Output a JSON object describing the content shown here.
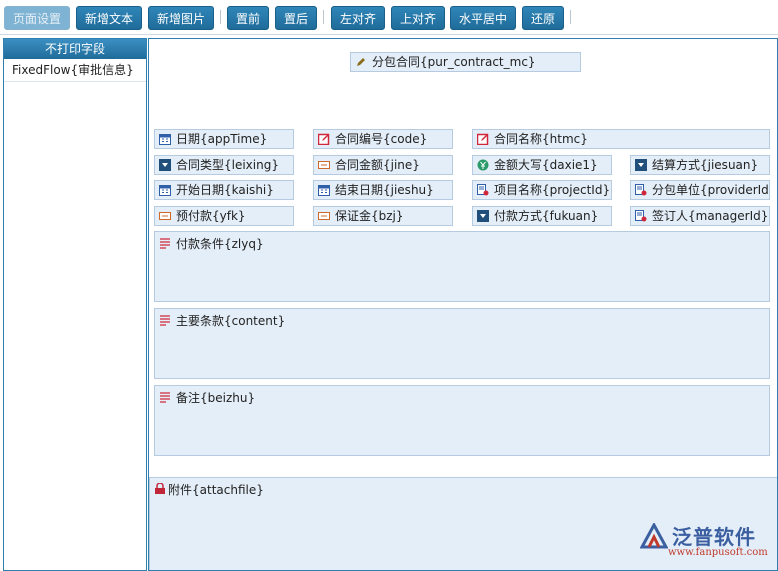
{
  "toolbar": {
    "page_setup": "页面设置",
    "add_text": "新增文本",
    "add_image": "新增图片",
    "to_front": "置前",
    "to_back": "置后",
    "align_left": "左对齐",
    "align_top": "上对齐",
    "center_h": "水平居中",
    "restore": "还原"
  },
  "left_panel": {
    "header": "不打印字段",
    "items": [
      "FixedFlow{审批信息}"
    ]
  },
  "fields": {
    "contract_name_top": "分包合同{pur_contract_mc}",
    "date": "日期{appTime}",
    "code": "合同编号{code}",
    "htmc": "合同名称{htmc}",
    "leixing": "合同类型{leixing}",
    "jine": "合同金额{jine}",
    "daxie": "金额大写{daxie1}",
    "jiesuan": "结算方式{jiesuan}",
    "kaishi": "开始日期{kaishi}",
    "jieshu": "结束日期{jieshu}",
    "project": "项目名称{projectId}",
    "provider": "分包单位{providerId}",
    "yfk": "预付款{yfk}",
    "bzj": "保证金{bzj}",
    "fukuan": "付款方式{fukuan}",
    "manager": "签订人{managerId}",
    "zlyq": "付款条件{zlyq}",
    "content": "主要条款{content}",
    "beizhu": "备注{beizhu}",
    "attach": "附件{attachfile}"
  },
  "watermark": {
    "brand": "泛普软件",
    "url": "www.fanpusoft.com"
  },
  "colors": {
    "button": "#1f6c9a",
    "field_bg": "#e4eef8",
    "border": "#2f7fb0"
  }
}
